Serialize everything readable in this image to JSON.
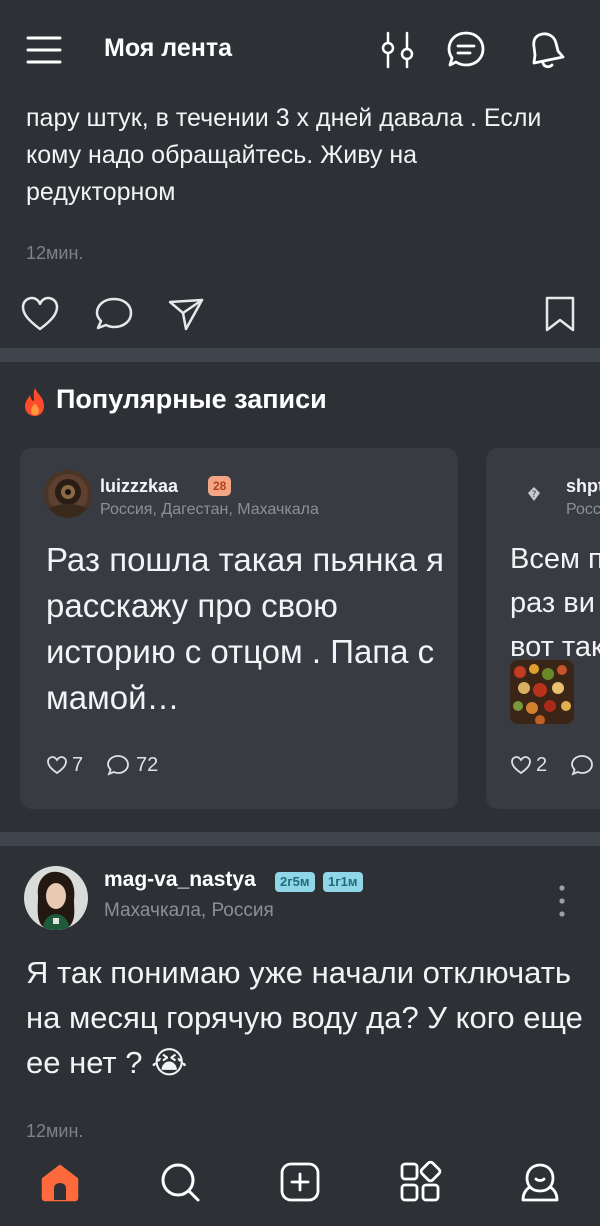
{
  "header": {
    "title": "Моя лента",
    "icons": [
      "menu-icon",
      "filter-icon",
      "messages-icon",
      "notifications-icon"
    ]
  },
  "post1": {
    "text": "пару штук, в течении 3 х дней давала . Если кому надо обращайтесь. Живу на редукторном",
    "time": "12мин."
  },
  "popular": {
    "title": "Популярные записи",
    "cards": [
      {
        "user": "luizzzkaa",
        "age": "28",
        "location": "Россия, Дагестан, Махачкала",
        "text": "Раз пошла такая пьянка я расскажу про свою историю с отцом .  Папа с мамой…",
        "likes": "7",
        "comments": "72"
      },
      {
        "user": "shpt",
        "location": "Россия",
        "text": "Всем п раз ви вот так",
        "likes": "2"
      }
    ]
  },
  "post2": {
    "user": "mag-va_nastya",
    "badge1": "2г5м",
    "badge2": "1г1м",
    "location": "Махачкала, Россия",
    "text": "Я так понимаю уже начали отключать на месяц горячую воду да? У кого еще ее нет ? 😭",
    "time": "12мин."
  },
  "bottom_nav": {
    "items": [
      "home-icon",
      "search-icon",
      "add-post-icon",
      "services-icon",
      "profile-icon"
    ],
    "active_color": "#ff6a3d"
  },
  "colors": {
    "background": "#2d3136",
    "card": "#383c42",
    "divider": "#3f454c",
    "accent": "#ff6a3d",
    "muted": "#7d8289"
  }
}
